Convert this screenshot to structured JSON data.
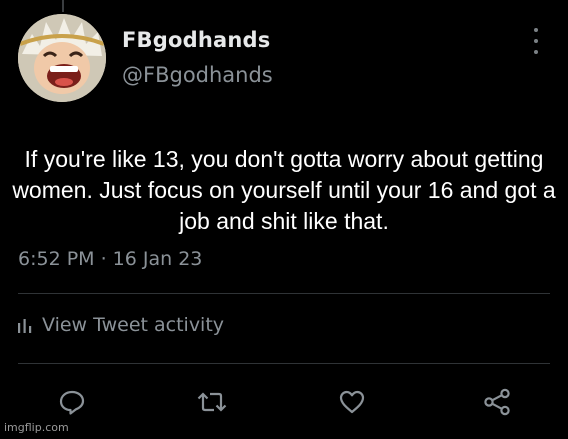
{
  "author": {
    "display_name": "FBgodhands",
    "handle": "@FBgodhands"
  },
  "tweet": {
    "text": "If you're like 13, you don't gotta worry about getting women. Just focus on yourself until your 16 and got a job and shit like that.",
    "timestamp": "6:52 PM · 16 Jan 23"
  },
  "activity_link": "View Tweet activity",
  "actions": [
    {
      "icon": "reply-icon"
    },
    {
      "icon": "retweet-icon"
    },
    {
      "icon": "like-icon"
    },
    {
      "icon": "share-icon"
    }
  ],
  "watermark": "imgflip.com",
  "colors": {
    "background": "#000000",
    "text": "#e7e9ea",
    "secondary": "#8b9298",
    "divider": "#2f3336"
  }
}
